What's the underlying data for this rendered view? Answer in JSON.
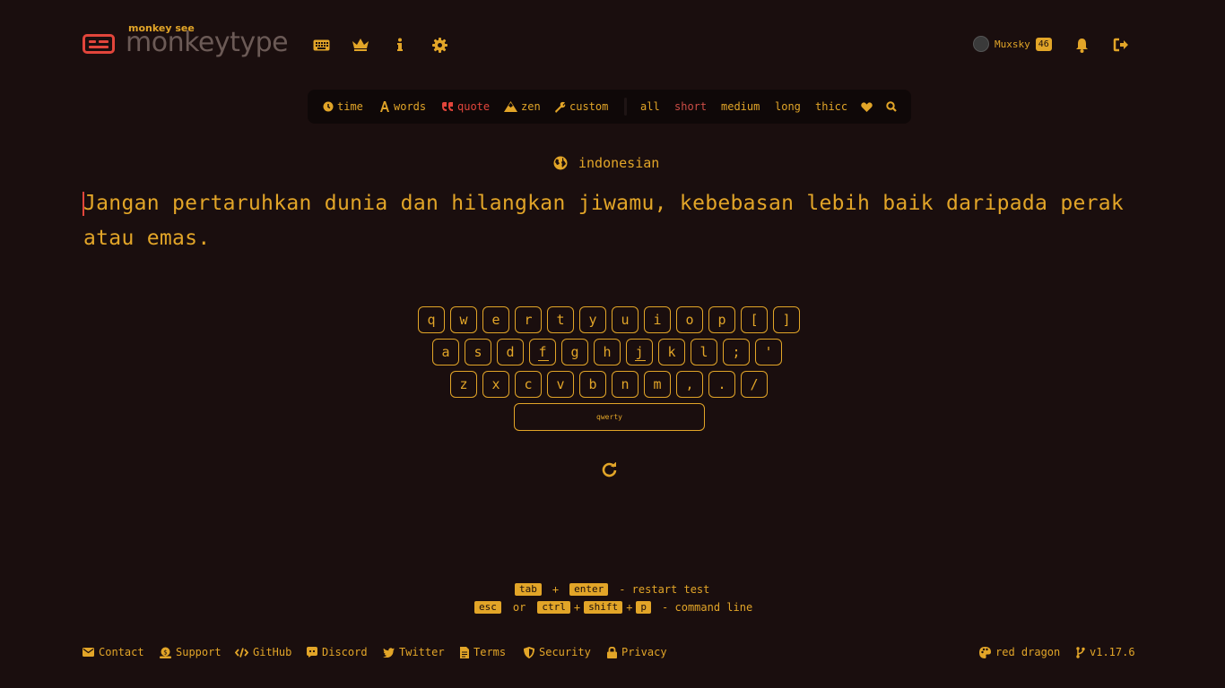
{
  "header": {
    "tagline": "monkey see",
    "logo_text": "monkeytype",
    "nav_icons": [
      "keyboard-icon",
      "crown-icon",
      "info-icon",
      "gear-icon"
    ],
    "user": {
      "name": "Muxsky",
      "level": "46"
    },
    "right_icons": [
      "bell-icon",
      "logout-icon"
    ]
  },
  "config_bar": {
    "modes": [
      {
        "label": "time",
        "icon": "clock-icon"
      },
      {
        "label": "words",
        "icon": "letter-a-icon"
      },
      {
        "label": "quote",
        "icon": "quote-icon",
        "active": true
      },
      {
        "label": "zen",
        "icon": "mountain-icon"
      },
      {
        "label": "custom",
        "icon": "wrench-icon"
      }
    ],
    "lengths": [
      {
        "label": "all"
      },
      {
        "label": "short",
        "active": true
      },
      {
        "label": "medium"
      },
      {
        "label": "long"
      },
      {
        "label": "thicc"
      }
    ],
    "extra_icons": [
      "heart-icon",
      "search-icon"
    ]
  },
  "test": {
    "language": "indonesian",
    "text_line1": "Jangan pertaruhkan dunia dan hilangkan jiwamu, kebebasan lebih baik daripada perak",
    "text_line2": "atau emas."
  },
  "keymap": {
    "row1": [
      "q",
      "w",
      "e",
      "r",
      "t",
      "y",
      "u",
      "i",
      "o",
      "p",
      "[",
      "]"
    ],
    "row2": [
      "a",
      "s",
      "d",
      "f",
      "g",
      "h",
      "j",
      "k",
      "l",
      ";",
      "'"
    ],
    "row3": [
      "z",
      "x",
      "c",
      "v",
      "b",
      "n",
      "m",
      ",",
      ".",
      "/"
    ],
    "space_label": "qwerty"
  },
  "hints": {
    "line1": {
      "k1": "tab",
      "plus": "+",
      "k2": "enter",
      "text": "- restart test"
    },
    "line2": {
      "k1": "esc",
      "or": "or",
      "k2": "ctrl",
      "plus1": "+",
      "k3": "shift",
      "plus2": "+",
      "k4": "p",
      "text": "- command line"
    }
  },
  "footer": {
    "links": [
      "Contact",
      "Support",
      "GitHub",
      "Discord",
      "Twitter",
      "Terms",
      "Security",
      "Privacy"
    ],
    "theme": "red dragon",
    "version": "v1.17.6"
  },
  "colors": {
    "bg": "#1a0e0e",
    "main": "#e2a528",
    "accent": "#e2453b",
    "sub": "#6b5a56"
  }
}
